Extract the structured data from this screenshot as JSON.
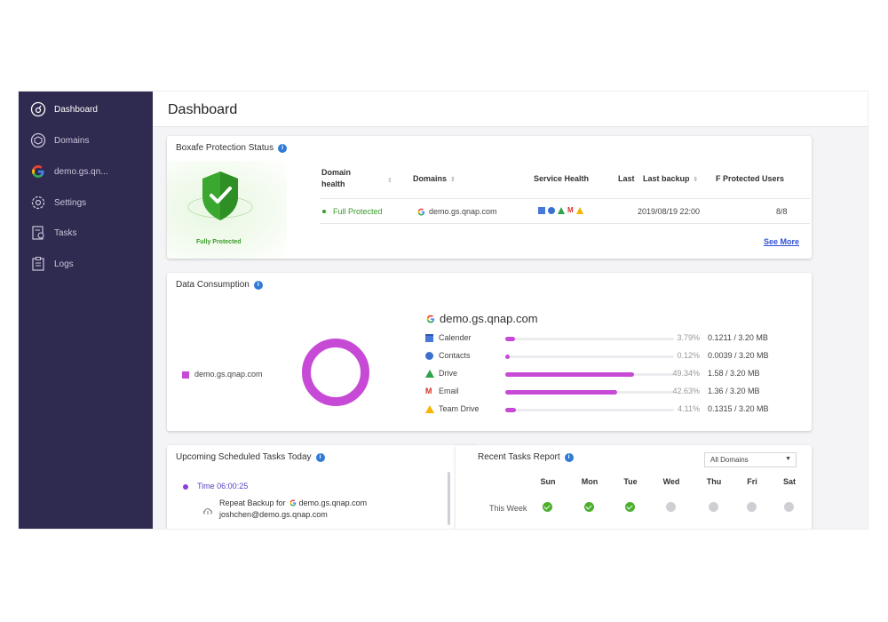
{
  "sidebar": {
    "items": [
      {
        "label": "Dashboard",
        "icon": "dashboard-icon",
        "active": true
      },
      {
        "label": "Domains",
        "icon": "domains-icon"
      },
      {
        "label": "demo.gs.qn...",
        "icon": "google-icon"
      },
      {
        "label": "Settings",
        "icon": "gear-icon"
      },
      {
        "label": "Tasks",
        "icon": "tasks-icon"
      },
      {
        "label": "Logs",
        "icon": "logs-icon"
      }
    ]
  },
  "header": {
    "title": "Dashboard"
  },
  "protection": {
    "title": "Boxafe Protection Status",
    "shield_label": "Fully Protected",
    "columns": {
      "domain_health": "Domain health",
      "domains": "Domains",
      "service_health": "Service Health",
      "last": "Last",
      "last_backup": "Last backup",
      "protected_users": "F Protected Users"
    },
    "row": {
      "health": "Full Protected",
      "domain": "demo.gs.qnap.com",
      "last_backup": "2019/08/19 22:00",
      "users": "8/8"
    },
    "see_more": "See More"
  },
  "data_consumption": {
    "title": "Data Consumption",
    "legend": "demo.gs.qnap.com",
    "domain": "demo.gs.qnap.com",
    "services": [
      {
        "name": "Calender",
        "pct_text": "3.79%",
        "pct": 3.79,
        "size": "0.1211 / 3.20 MB",
        "icon": "calendar-icon"
      },
      {
        "name": "Contacts",
        "pct_text": "0.12%",
        "pct": 0.12,
        "size": "0.0039 / 3.20 MB",
        "icon": "contacts-icon"
      },
      {
        "name": "Drive",
        "pct_text": "49.34%",
        "pct": 49.34,
        "size": "1.58 / 3.20 MB",
        "icon": "drive-icon"
      },
      {
        "name": "Email",
        "pct_text": "42.63%",
        "pct": 42.63,
        "size": "1.36 / 3.20 MB",
        "icon": "gmail-icon"
      },
      {
        "name": "Team Drive",
        "pct_text": "4.11%",
        "pct": 4.11,
        "size": "0.1315 / 3.20 MB",
        "icon": "team-drive-icon"
      }
    ]
  },
  "upcoming": {
    "title": "Upcoming Scheduled Tasks Today",
    "time": "Time 06:00:25",
    "task": "Repeat Backup for",
    "task_domain": "demo.gs.qnap.com",
    "task_user": "joshchen@demo.gs.qnap.com"
  },
  "recent": {
    "title": "Recent Tasks Report",
    "filter": "All Domains",
    "days": [
      "Sun",
      "Mon",
      "Tue",
      "Wed",
      "Thu",
      "Fri",
      "Sat"
    ],
    "week_label": "This Week",
    "status": [
      "ok",
      "ok",
      "ok",
      "none",
      "none",
      "none",
      "none"
    ]
  },
  "colors": {
    "sidebar": "#2f2a4f",
    "accent": "#c74ad6",
    "ok": "#4caf2e",
    "link": "#2f4fd6"
  }
}
